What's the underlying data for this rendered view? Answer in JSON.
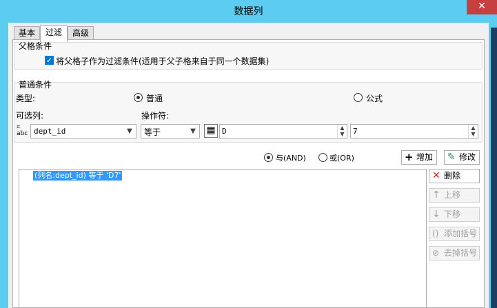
{
  "window": {
    "title": "数据列",
    "close": "✕"
  },
  "tabs": [
    {
      "label": "基本"
    },
    {
      "label": "过滤"
    },
    {
      "label": "高级"
    }
  ],
  "parent_group": {
    "title": "父格条件",
    "checkbox_label": "将父格子作为过滤条件(适用于父子格来自于同一个数据集)",
    "checked": true
  },
  "general_group": {
    "title": "普通条件",
    "type_label": "类型:",
    "type_options": [
      "普通",
      "公式"
    ],
    "type_selected": "普通",
    "column_label": "可选列:",
    "operator_label": "操作符:",
    "column_value": "dept_id",
    "operator_value": "等于",
    "value_field": "D",
    "value_field2": "7"
  },
  "logic": {
    "and_label": "与(AND)",
    "or_label": "或(OR)",
    "selected": "与(AND)"
  },
  "actions": {
    "add": "增加",
    "modify": "修改"
  },
  "conditions": [
    "(列名:dept_id) 等于 'D7'"
  ],
  "side_buttons": {
    "delete": "删除",
    "move_up": "上移",
    "move_down": "下移",
    "add_bracket": "添加括号",
    "remove_bracket": "去掉括号"
  },
  "colors": {
    "title_bar": "#5ccdf0",
    "selection": "#3399ff",
    "close": "#c7403f"
  }
}
